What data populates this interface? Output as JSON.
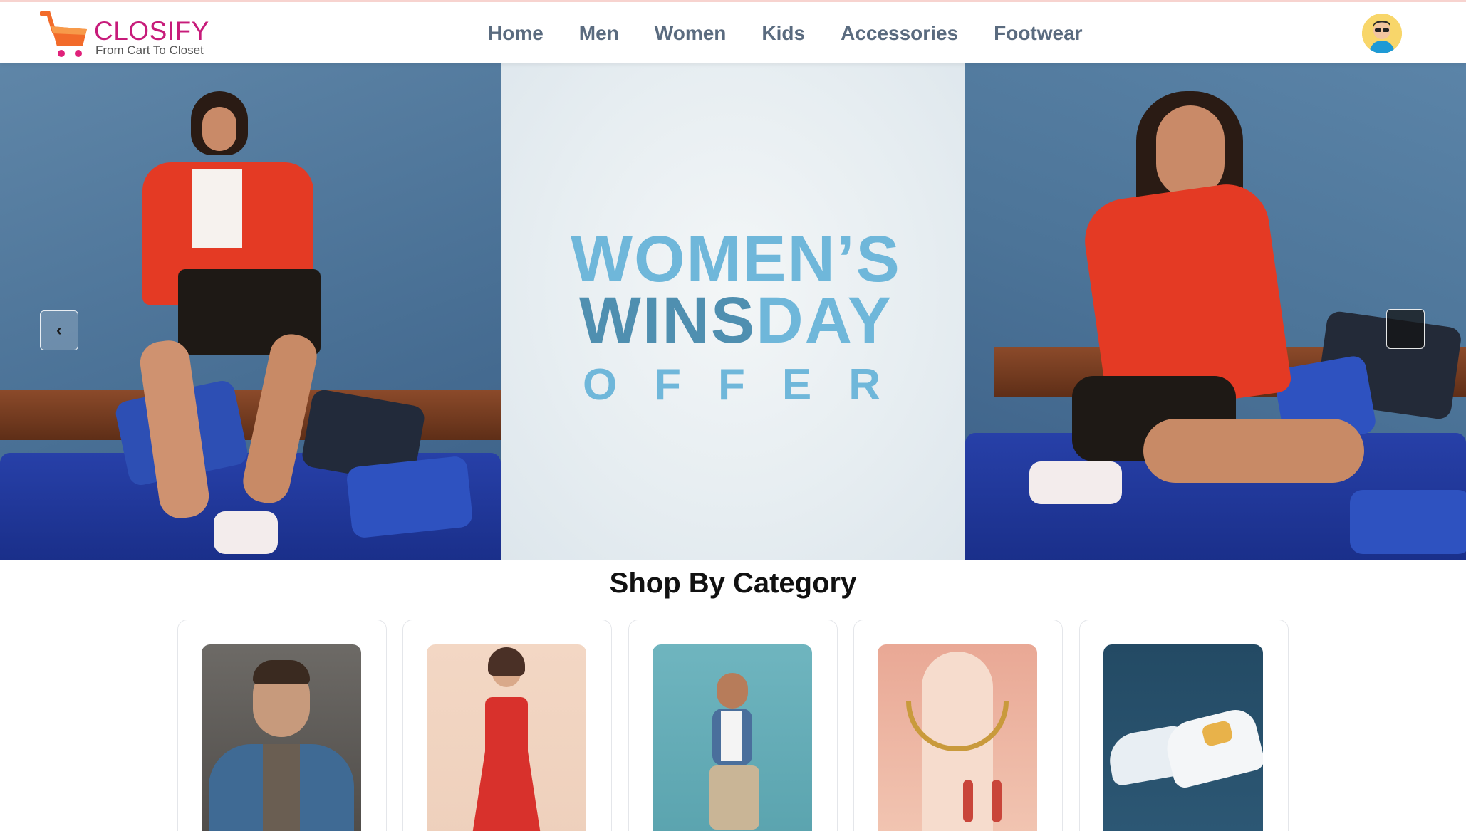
{
  "brand": {
    "name": "CLOSIFY",
    "tagline": "From Cart To Closet",
    "accent": "#e0217a",
    "cart_color": "#f26b2a"
  },
  "nav": {
    "links": [
      {
        "label": "Home"
      },
      {
        "label": "Men"
      },
      {
        "label": "Women"
      },
      {
        "label": "Kids"
      },
      {
        "label": "Accessories"
      },
      {
        "label": "Footwear"
      }
    ]
  },
  "hero": {
    "offer_line1": "WOMEN’S",
    "offer_line2a": "WINS",
    "offer_line2b": "DAY",
    "offer_line3": "OFFER",
    "prev_label": "‹"
  },
  "categories": {
    "title": "Shop By Category"
  },
  "icons": {
    "cart": "shopping-cart-icon",
    "avatar": "user-avatar-icon",
    "prev": "chevron-left-icon",
    "next": "chevron-right-icon"
  }
}
